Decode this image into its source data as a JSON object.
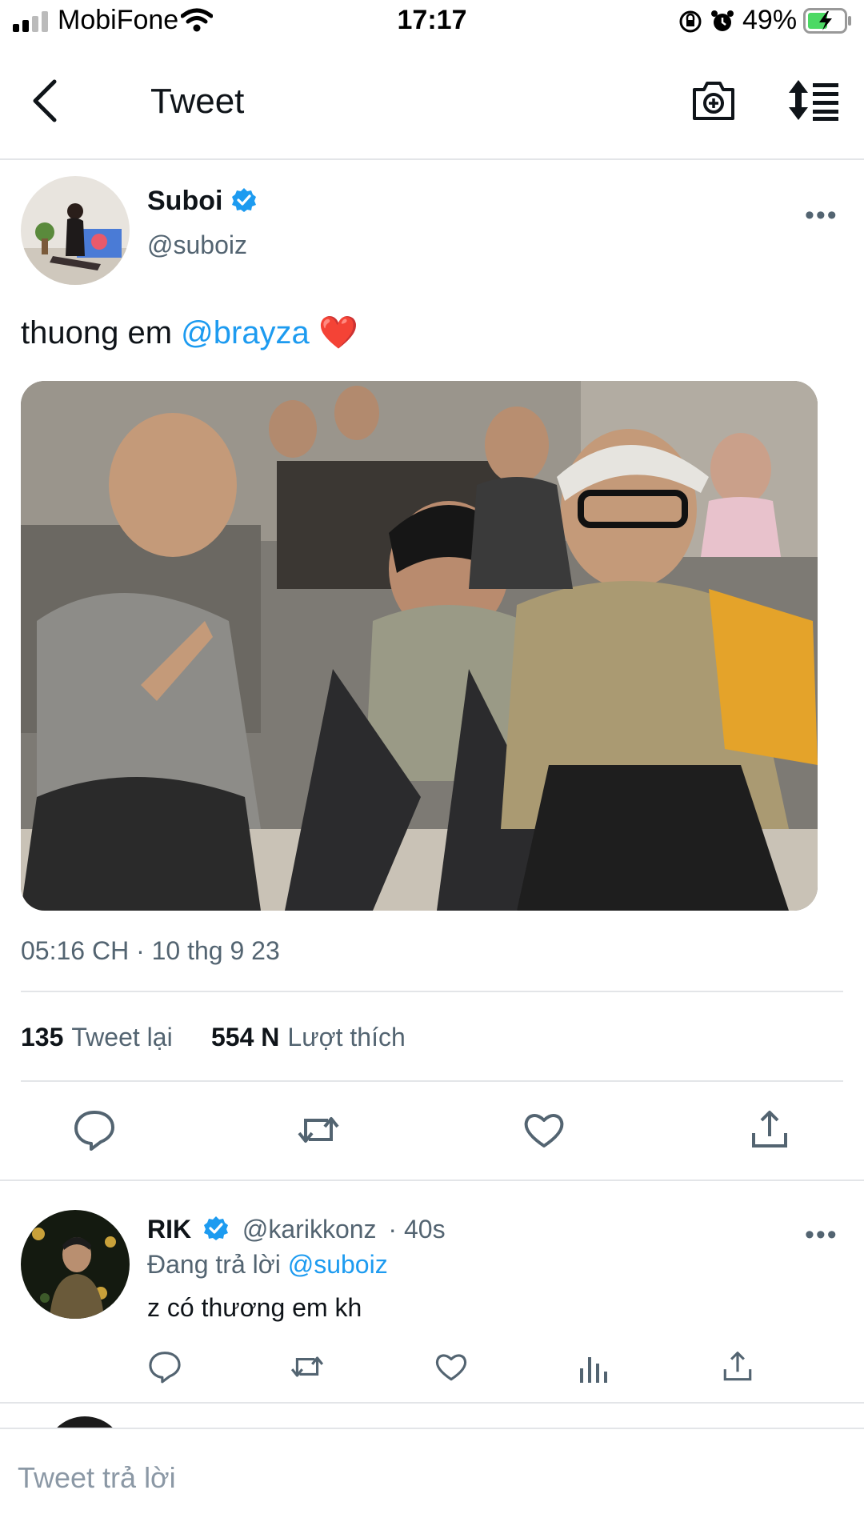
{
  "status_bar": {
    "carrier": "MobiFone",
    "time": "17:17",
    "battery": "49%"
  },
  "nav": {
    "title": "Tweet"
  },
  "tweet": {
    "author_name": "Suboi",
    "author_handle": "@suboiz",
    "text_prefix": "thuong em ",
    "mention": "@brayza",
    "emoji": "❤️",
    "timestamp": "05:16 CH · 10 thg 9 23",
    "retweets_count": "135",
    "retweets_label": "Tweet lại",
    "likes_count": "554 N",
    "likes_label": "Lượt thích",
    "more": "•••"
  },
  "reply": {
    "author_name": "RIK",
    "author_handle": "@karikkonz",
    "time": "· 40s",
    "replying_prefix": "Đang trả lời ",
    "replying_to": "@suboiz",
    "text": "z có thương em kh",
    "more": "•••"
  },
  "composer": {
    "placeholder": "Tweet trả lời"
  },
  "colors": {
    "accent": "#1d9bf0",
    "text_primary": "#0f1419",
    "text_secondary": "#536471",
    "divider": "#e3e5e8"
  },
  "icons": [
    "back-arrow-icon",
    "camera-plus-icon",
    "sort-icon",
    "verified-badge-icon",
    "reply-icon",
    "retweet-icon",
    "like-icon",
    "share-icon",
    "analytics-icon",
    "signal-icon",
    "wifi-icon",
    "lock-rotation-icon",
    "alarm-icon",
    "battery-icon"
  ]
}
